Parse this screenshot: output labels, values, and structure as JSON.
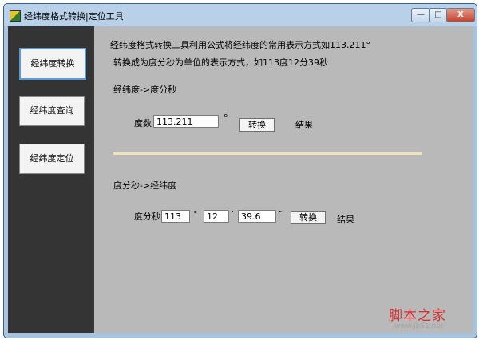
{
  "window": {
    "title": "经纬度格式转换|定位工具",
    "controls": {
      "minimize": "—",
      "maximize": "□",
      "close": "X"
    }
  },
  "sidebar": {
    "items": [
      {
        "label": "经纬度转换",
        "active": true
      },
      {
        "label": "经纬度查询",
        "active": false
      },
      {
        "label": "经纬度定位",
        "active": false
      }
    ]
  },
  "main": {
    "intro_line1": "经纬度格式转换工具利用公式将经纬度的常用表示方式如113.211°",
    "intro_line2": "转换成为度分秒为单位的表示方式，如113度12分39秒",
    "section1": {
      "heading": "经纬度->度分秒",
      "degree_label": "度数",
      "degree_value": "113.211",
      "degree_symbol": "°",
      "convert_label": "转换",
      "result_label": "结果"
    },
    "section2": {
      "heading": "度分秒->经纬度",
      "dms_label": "度分秒",
      "degree_value": "113",
      "degree_symbol": "°",
      "minute_value": "12",
      "minute_symbol": "′",
      "second_value": "39.6",
      "second_symbol": "″",
      "convert_label": "转换",
      "result_label": "结果"
    }
  },
  "watermark": {
    "text": "脚本之家",
    "url": "www.jb51.net"
  }
}
